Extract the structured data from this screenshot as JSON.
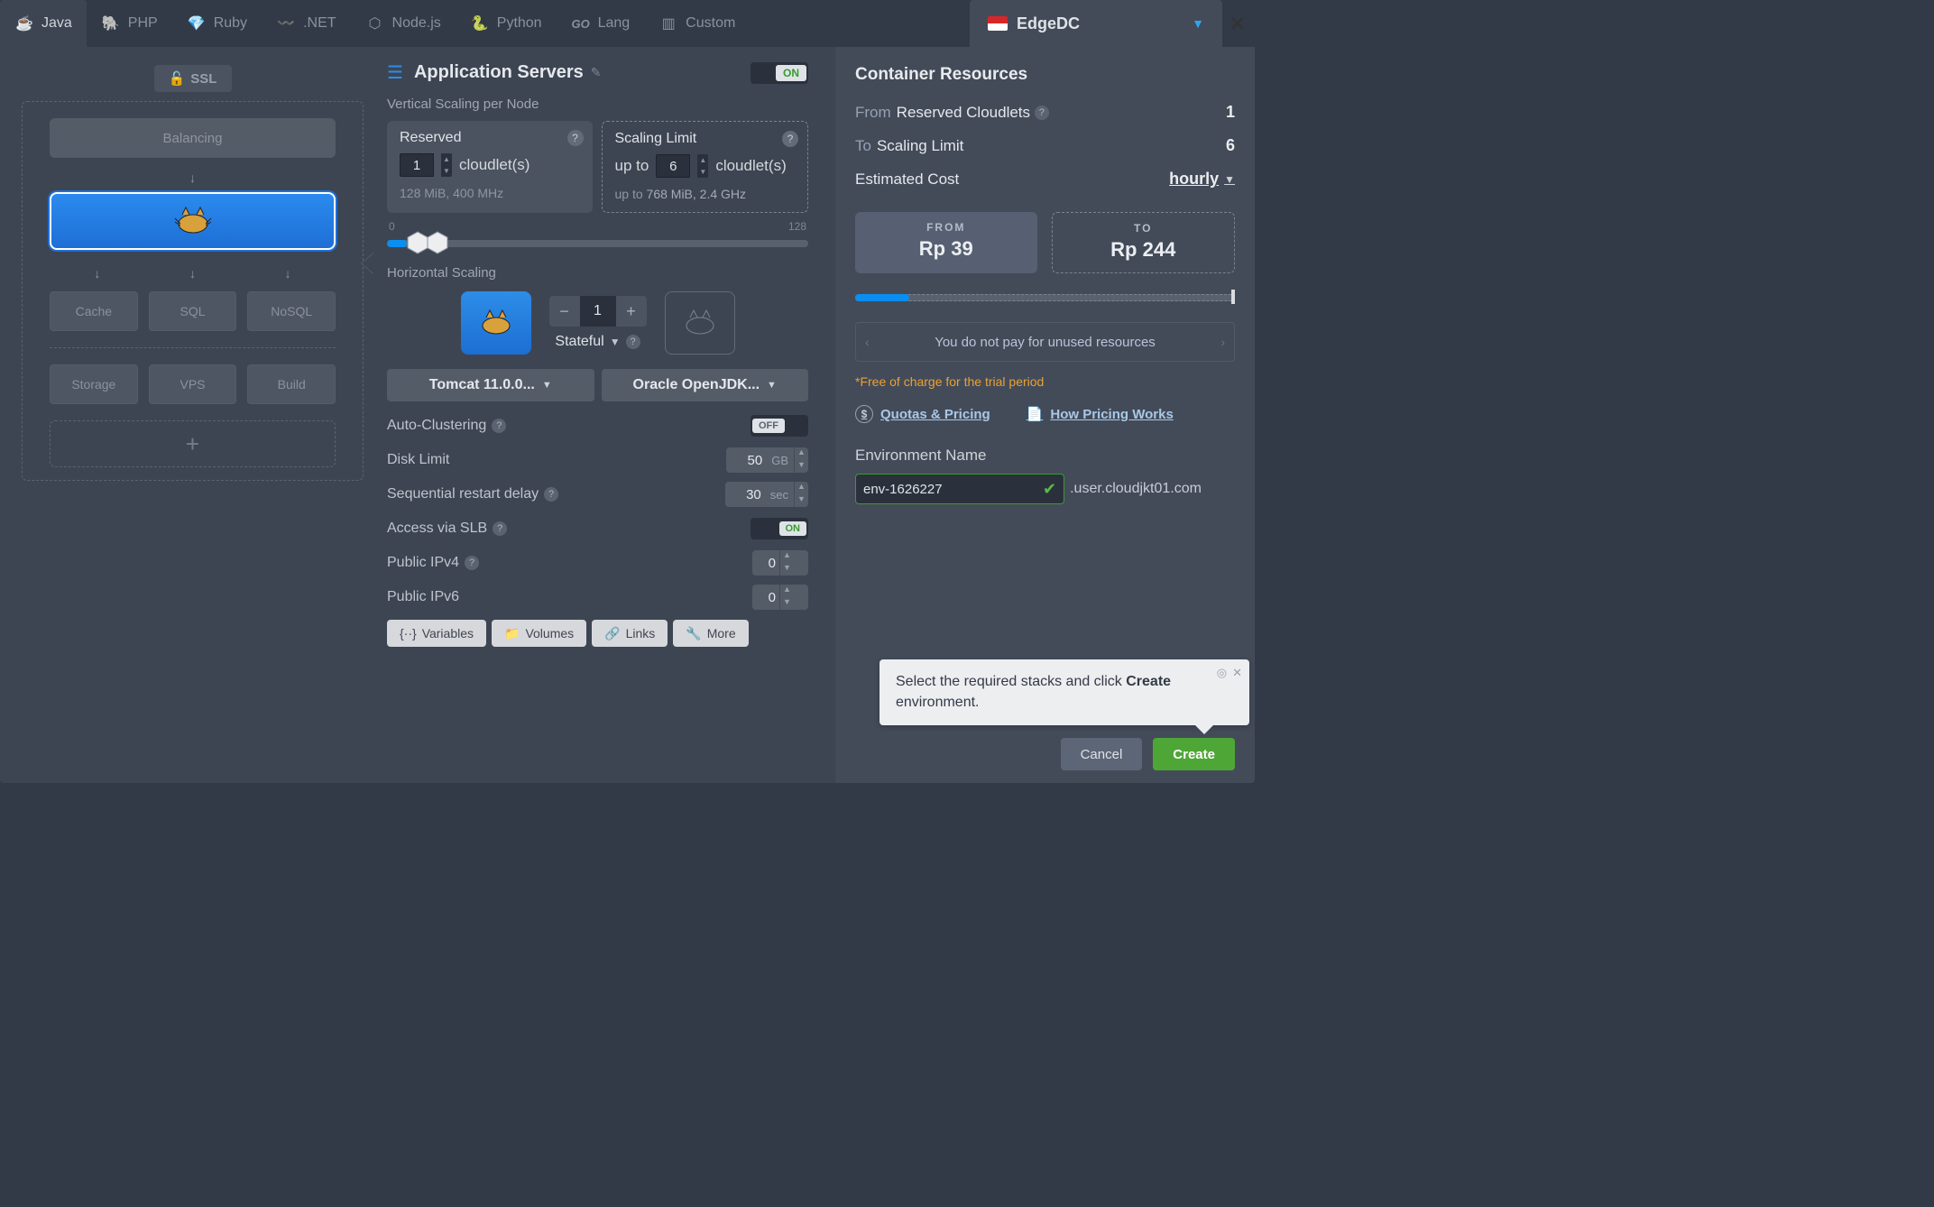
{
  "tabs": [
    {
      "label": "Java",
      "icon": "java",
      "active": true
    },
    {
      "label": "PHP",
      "icon": "php"
    },
    {
      "label": "Ruby",
      "icon": "ruby"
    },
    {
      "label": ".NET",
      "icon": "dotnet"
    },
    {
      "label": "Node.js",
      "icon": "node"
    },
    {
      "label": "Python",
      "icon": "python"
    },
    {
      "label": "Lang",
      "icon": "go"
    },
    {
      "label": "Custom",
      "icon": "custom"
    }
  ],
  "region": {
    "name": "EdgeDC",
    "flag": "id"
  },
  "topology": {
    "ssl": "SSL",
    "balancing": "Balancing",
    "layers": [
      "Cache",
      "SQL",
      "NoSQL"
    ],
    "extras": [
      "Storage",
      "VPS",
      "Build"
    ]
  },
  "appServers": {
    "title": "Application Servers",
    "enabled": "ON",
    "vertical_label": "Vertical Scaling per Node",
    "reserved": {
      "title": "Reserved",
      "value": "1",
      "unit": "cloudlet(s)",
      "detail": "128 MiB, 400 MHz"
    },
    "limit": {
      "title": "Scaling Limit",
      "prefix": "up to",
      "value": "6",
      "unit": "cloudlet(s)",
      "detail_prefix": "up to",
      "detail": "768 MiB, 2.4 GHz"
    },
    "slider": {
      "min": "0",
      "max": "128"
    },
    "horizontal_label": "Horizontal Scaling",
    "nodes": "1",
    "mode": "Stateful",
    "stack": "Tomcat 11.0.0...",
    "jdk": "Oracle OpenJDK...",
    "settings": {
      "auto_clustering": {
        "label": "Auto-Clustering",
        "state": "OFF"
      },
      "disk_limit": {
        "label": "Disk Limit",
        "value": "50",
        "unit": "GB"
      },
      "restart_delay": {
        "label": "Sequential restart delay",
        "value": "30",
        "unit": "sec"
      },
      "slb": {
        "label": "Access via SLB",
        "state": "ON"
      },
      "ipv4": {
        "label": "Public IPv4",
        "value": "0"
      },
      "ipv6": {
        "label": "Public IPv6",
        "value": "0"
      }
    },
    "buttons": {
      "variables": "Variables",
      "volumes": "Volumes",
      "links": "Links",
      "more": "More"
    }
  },
  "resources": {
    "title": "Container Resources",
    "from_label": "From",
    "from_text": "Reserved Cloudlets",
    "from_val": "1",
    "to_label": "To",
    "to_text": "Scaling Limit",
    "to_val": "6",
    "cost_label": "Estimated Cost",
    "cost_period": "hourly",
    "price_from_label": "FROM",
    "price_from": "Rp 39",
    "price_to_label": "TO",
    "price_to": "Rp 244",
    "info": "You do not pay for unused resources",
    "free_note": "*Free of charge for the trial period",
    "quotas": "Quotas & Pricing",
    "how": "How Pricing Works",
    "env_label": "Environment Name",
    "env_value": "env-1626227",
    "domain": ".user.cloudjkt01.com",
    "tooltip_a": "Select the required stacks and click ",
    "tooltip_b": "Create",
    "tooltip_c": " environment.",
    "cancel": "Cancel",
    "create": "Create"
  }
}
